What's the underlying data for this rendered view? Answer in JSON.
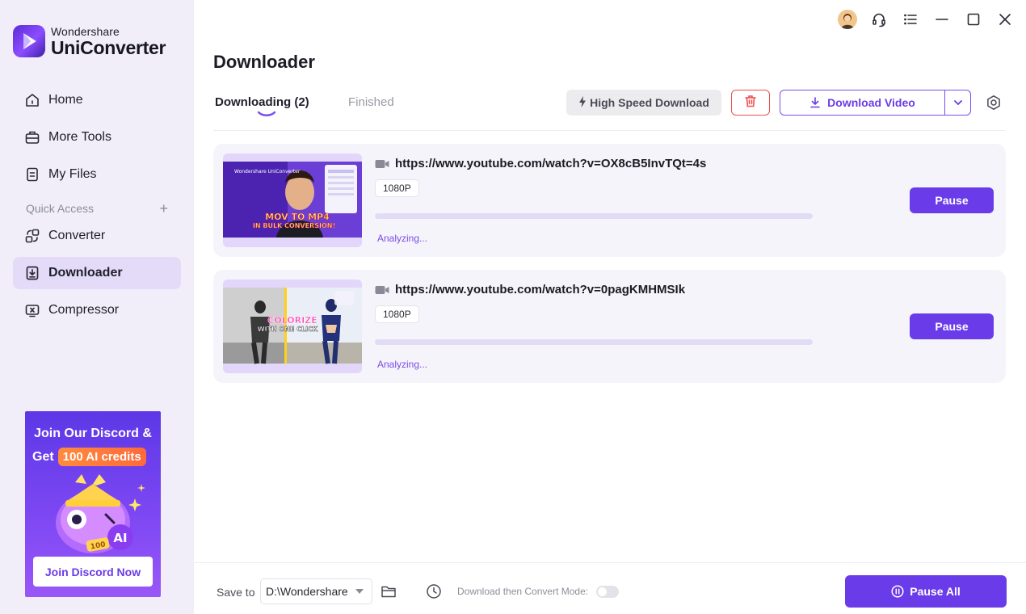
{
  "brand": {
    "top": "Wondershare",
    "name": "UniConverter"
  },
  "sidebar": {
    "items": [
      {
        "label": "Home",
        "icon": "home-icon"
      },
      {
        "label": "More Tools",
        "icon": "toolbox-icon"
      },
      {
        "label": "My Files",
        "icon": "file-icon"
      }
    ],
    "quick_access": {
      "label": "Quick Access",
      "add": "+"
    },
    "quick_items": [
      {
        "label": "Converter",
        "icon": "converter-icon"
      },
      {
        "label": "Downloader",
        "icon": "downloader-icon",
        "active": true
      },
      {
        "label": "Compressor",
        "icon": "compressor-icon"
      }
    ]
  },
  "promo": {
    "line1": "Join Our Discord &",
    "line2_prefix": "Get",
    "credits": "100 AI credits",
    "badge": "100",
    "ai": "AI",
    "button": "Join Discord Now"
  },
  "header": {
    "title": "Downloader"
  },
  "tabs": {
    "downloading": "Downloading (2)",
    "finished": "Finished"
  },
  "toolbar": {
    "high_speed": "High Speed Download",
    "download_video": "Download Video"
  },
  "downloads": [
    {
      "url": "https://www.youtube.com/watch?v=OX8cB5InvTQt=4s",
      "resolution": "1080P",
      "status": "Analyzing...",
      "progress": 0,
      "action": "Pause",
      "thumb_brand": "Wondershare UniConverter",
      "thumb_line1": "MOV TO MP4",
      "thumb_line2": "IN BULK CONVERSION!"
    },
    {
      "url": "https://www.youtube.com/watch?v=0pagKMHMSIk",
      "resolution": "1080P",
      "status": "Analyzing...",
      "progress": 0,
      "action": "Pause",
      "thumb_line1": "COLORIZE",
      "thumb_line2": "WITH ONE CLICK"
    }
  ],
  "footer": {
    "save_to": "Save to",
    "path": "D:\\Wondershare",
    "mode_label": "Download then Convert Mode:",
    "mode_on": false,
    "pause_all": "Pause All"
  },
  "colors": {
    "accent": "#6a3be8",
    "sidebar_bg": "#f1eefa",
    "danger": "#ef4e4e"
  }
}
